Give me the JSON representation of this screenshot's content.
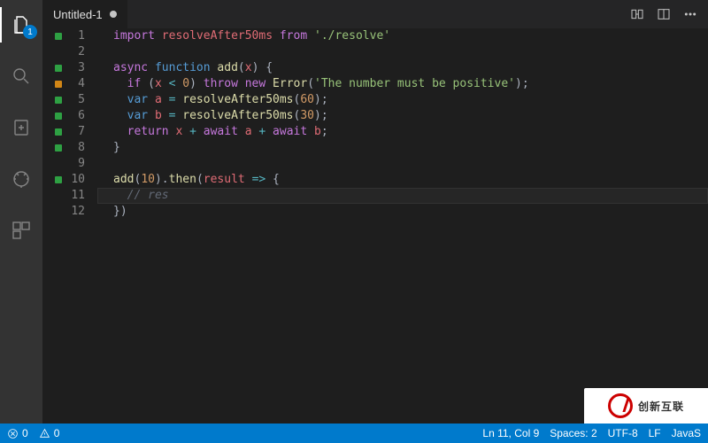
{
  "activity": {
    "files_badge": "1"
  },
  "tab": {
    "title": "Untitled-1"
  },
  "code": {
    "lines": [
      {
        "n": 1,
        "mark": "green",
        "html": "<span class='tok-key'>import</span> <span class='tok-id'>resolveAfter50ms</span> <span class='tok-key'>from</span> <span class='tok-str'>'./resolve'</span>"
      },
      {
        "n": 2,
        "mark": "",
        "html": ""
      },
      {
        "n": 3,
        "mark": "green",
        "html": "<span class='tok-key'>async</span> <span class='tok-key2'>function</span> <span class='tok-fn'>add</span><span class='tok-p'>(</span><span class='tok-id'>x</span><span class='tok-p'>) {</span>"
      },
      {
        "n": 4,
        "mark": "orange",
        "html": "  <span class='tok-key'>if</span> <span class='tok-p'>(</span><span class='tok-id'>x</span> <span class='tok-op'>&lt;</span> <span class='tok-num'>0</span><span class='tok-p'>)</span> <span class='tok-key'>throw</span> <span class='tok-key'>new</span> <span class='tok-fn'>Error</span><span class='tok-p'>(</span><span class='tok-str'>'The number must be positive'</span><span class='tok-p'>);</span>"
      },
      {
        "n": 5,
        "mark": "green",
        "html": "  <span class='tok-key2'>var</span> <span class='tok-id'>a</span> <span class='tok-op'>=</span> <span class='tok-fn'>resolveAfter50ms</span><span class='tok-p'>(</span><span class='tok-num'>60</span><span class='tok-p'>);</span>"
      },
      {
        "n": 6,
        "mark": "green",
        "html": "  <span class='tok-key2'>var</span> <span class='tok-id'>b</span> <span class='tok-op'>=</span> <span class='tok-fn'>resolveAfter50ms</span><span class='tok-p'>(</span><span class='tok-num'>30</span><span class='tok-p'>);</span>"
      },
      {
        "n": 7,
        "mark": "green",
        "html": "  <span class='tok-key'>return</span> <span class='tok-id'>x</span> <span class='tok-op'>+</span> <span class='tok-key'>await</span> <span class='tok-id'>a</span> <span class='tok-op'>+</span> <span class='tok-key'>await</span> <span class='tok-id'>b</span><span class='tok-p'>;</span>"
      },
      {
        "n": 8,
        "mark": "green",
        "html": "<span class='tok-p'>}</span>"
      },
      {
        "n": 9,
        "mark": "",
        "html": ""
      },
      {
        "n": 10,
        "mark": "green",
        "html": "<span class='tok-fn'>add</span><span class='tok-p'>(</span><span class='tok-num'>10</span><span class='tok-p'>).</span><span class='tok-fn'>then</span><span class='tok-p'>(</span><span class='tok-id'>result</span> <span class='tok-op'>=&gt;</span> <span class='tok-p'>{</span>"
      },
      {
        "n": 11,
        "mark": "",
        "html": "  <span class='tok-cm'>// res</span>",
        "current": true
      },
      {
        "n": 12,
        "mark": "",
        "html": "<span class='tok-p'>})</span>"
      }
    ]
  },
  "status": {
    "errors": "0",
    "warnings": "0",
    "cursor": "Ln 11, Col 9",
    "spaces": "Spaces: 2",
    "encoding": "UTF-8",
    "eol": "LF",
    "language": "JavaS"
  },
  "watermark": {
    "text": "创新互联"
  }
}
